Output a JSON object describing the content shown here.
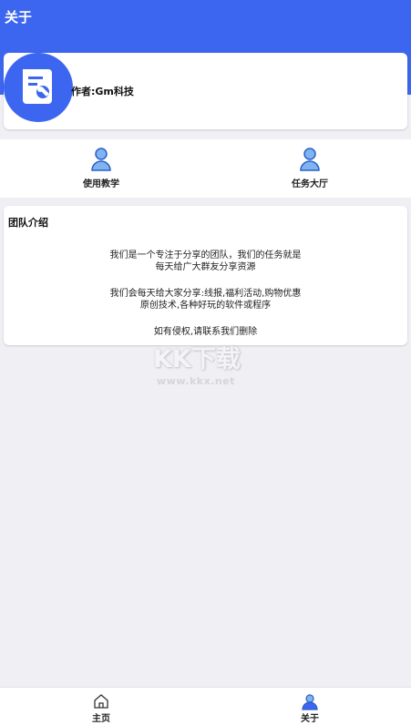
{
  "header": {
    "title": "关于"
  },
  "author": {
    "text": "作者:Gm科技"
  },
  "shortcuts": [
    {
      "label": "使用教学",
      "icon": "person-icon"
    },
    {
      "label": "任务大厅",
      "icon": "person-icon"
    }
  ],
  "team": {
    "title": "团队介绍",
    "lines": [
      "我们是一个专注于分享的团队，我们的任务就是",
      "每天给广大群友分享资源",
      "我们会每天给大家分享:线报,福利活动,购物优惠",
      "原创技术,各种好玩的软件或程序",
      "如有侵权,请联系我们删除"
    ]
  },
  "watermark": {
    "text": "KK下载",
    "url": "www.kkx.net"
  },
  "tabbar": {
    "items": [
      {
        "label": "主页",
        "icon": "home-icon"
      },
      {
        "label": "关于",
        "icon": "person-icon"
      }
    ]
  },
  "colors": {
    "primary": "#3d66f0",
    "background": "#efeff4",
    "icon_light": "#7fb4f0"
  }
}
